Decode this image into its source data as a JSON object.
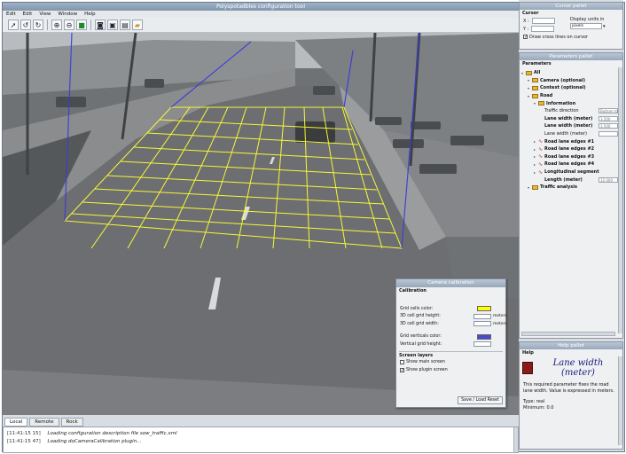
{
  "main_window": {
    "title": "Polyspotadbles configuration tool",
    "menu": [
      "Edit",
      "Edit",
      "View",
      "Window",
      "Help"
    ]
  },
  "toolbar": {
    "icons": [
      "pointer-icon",
      "rotate-left-icon",
      "rotate-right-icon",
      "zoom-in-icon",
      "zoom-out-icon",
      "zoom-fit-icon",
      "camera-icon",
      "save-icon",
      "gallery-icon",
      "folder-open-icon"
    ]
  },
  "log": {
    "tabs": [
      "Local",
      "Remote",
      "Rock"
    ],
    "active_tab": "Local",
    "entries": [
      {
        "time": "[11:41:15 15]",
        "text": "Loading configuration description file sow_traffic.xml"
      },
      {
        "time": "[11:41:15 47]",
        "text": "Loading doCameraCalibration plugin..."
      }
    ]
  },
  "camera_calibration": {
    "title": "Camera calibration",
    "section_calibration": "Calibration",
    "grid_cells_color_label": "Grid cells color:",
    "grid_cells_color": "#ffff00",
    "cell_height_label": "3D cell grid height:",
    "cell_height_unit": "meters",
    "cell_width_label": "3D cell grid width:",
    "cell_width_unit": "meters",
    "grid_verticals_color_label": "Grid verticals color:",
    "grid_verticals_color": "#4a4ad0",
    "vertical_grid_height_label": "Vertical grid height:",
    "section_screen_layers": "Screen layers",
    "show_main_screen": "Show main screen",
    "show_main_screen_checked": false,
    "show_plugin_screen": "Show plugin screen",
    "show_plugin_screen_checked": true,
    "reset_button": "Save / Load Reset"
  },
  "cursor_pallet": {
    "title": "Cursor pallet",
    "section": "Cursor",
    "x_label": "X :",
    "y_label": "Y :",
    "display_units_label": "Display units in",
    "display_units_value": "pixels",
    "draw_cross_label": "Draw cross lines on cursor",
    "draw_cross_checked": true
  },
  "parameters_pallet": {
    "title": "Parameters pallet",
    "section": "Parameters",
    "tree": [
      {
        "kind": "folder",
        "label": "All",
        "level": 0,
        "bold": true
      },
      {
        "kind": "folder",
        "label": "Camera (optional)",
        "level": 1,
        "bold": true
      },
      {
        "kind": "folder",
        "label": "Context (optional)",
        "level": 1,
        "bold": true
      },
      {
        "kind": "folder",
        "label": "Road",
        "level": 1,
        "bold": true
      },
      {
        "kind": "folder",
        "label": "Information",
        "level": 2,
        "bold": true
      },
      {
        "kind": "field",
        "label": "Traffic direction",
        "level": 3,
        "value": "Bottom to t"
      },
      {
        "kind": "field",
        "label": "Lane width (meter)",
        "level": 3,
        "value": "3.500",
        "bold": true
      },
      {
        "kind": "field",
        "label": "Lane width (meter)",
        "level": 3,
        "value": "3.500",
        "bold": true
      },
      {
        "kind": "field",
        "label": "Lane width (meter)",
        "level": 3,
        "value": ""
      },
      {
        "kind": "curve",
        "label": "Road lane edges #1",
        "level": 2,
        "bold": true
      },
      {
        "kind": "curve",
        "label": "Road lane edges #2",
        "level": 2,
        "bold": true
      },
      {
        "kind": "curve",
        "label": "Road lane edges #3",
        "level": 2,
        "bold": true
      },
      {
        "kind": "curve",
        "label": "Road lane edges #4",
        "level": 2,
        "bold": true
      },
      {
        "kind": "curve",
        "label": "Longitudinal segment",
        "level": 2,
        "bold": true
      },
      {
        "kind": "field",
        "label": "Length (meter)",
        "level": 3,
        "value": "32.000",
        "bold": true
      },
      {
        "kind": "folder",
        "label": "Traffic analysis",
        "level": 1,
        "bold": true
      }
    ]
  },
  "help_pallet": {
    "title": "Help pallet",
    "section": "Help",
    "heading_line1": "Lane width",
    "heading_line2": "(meter)",
    "body": "This required parameter fixes the road lane width. Value is expressed in meters.",
    "type_line": "Type: real",
    "minimum_line": "Minimum: 0.0"
  },
  "colors": {
    "grid_yellow": "#ffff00",
    "vertical_blue": "#3a3ad8",
    "road": "#6e7073",
    "sidewalk": "#9a9c9e",
    "grass": "#55585a"
  }
}
